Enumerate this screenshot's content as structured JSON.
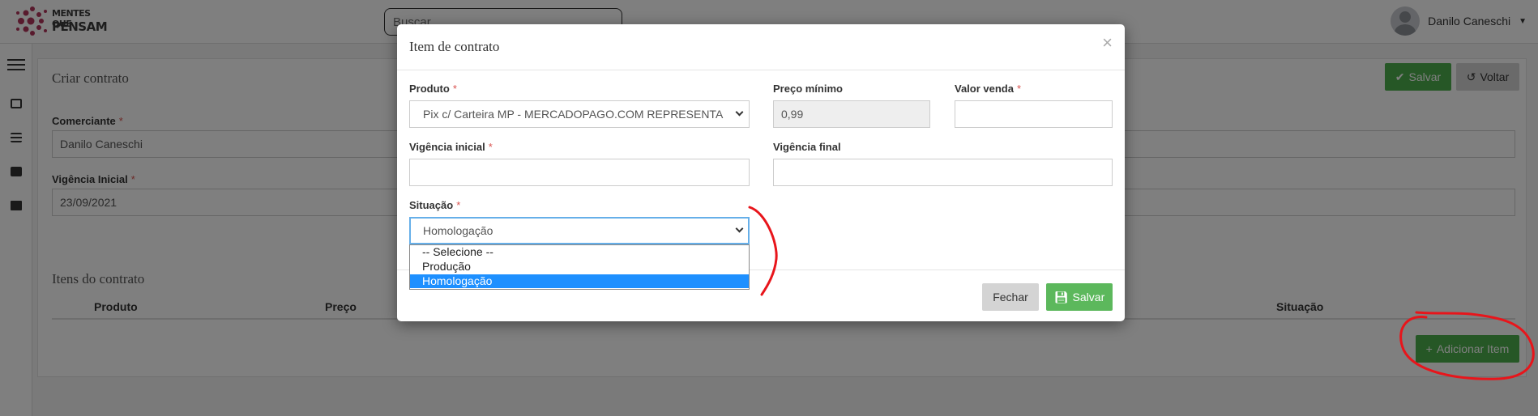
{
  "header": {
    "logo_line1": "MENTES QUE",
    "logo_line2": "PENSAM",
    "search_placeholder": "Buscar",
    "user_name": "Danilo Caneschi"
  },
  "sidebar": {
    "icons": [
      "menu-icon",
      "contact-icon",
      "list-icon",
      "id-card-icon",
      "mail-icon"
    ]
  },
  "page": {
    "title": "Criar contrato",
    "save_label": "Salvar",
    "back_label": "Voltar",
    "fields": {
      "comerciante_label": "Comerciante",
      "comerciante_value": "Danilo Caneschi",
      "vigencia_inicial_label": "Vigência Inicial",
      "vigencia_inicial_value": "23/09/2021"
    },
    "items_title": "Itens do contrato",
    "columns": [
      "Produto",
      "Preço",
      "Situação"
    ],
    "add_item_label": "Adicionar Item"
  },
  "modal": {
    "title": "Item de contrato",
    "close_symbol": "×",
    "produto_label": "Produto",
    "produto_value": "Pix c/ Carteira MP - MERCADOPAGO.COM REPRESENTA",
    "preco_minimo_label": "Preço mínimo",
    "preco_minimo_value": "0,99",
    "valor_venda_label": "Valor venda",
    "vigencia_inicial_label": "Vigência inicial",
    "vigencia_final_label": "Vigência final",
    "situacao_label": "Situação",
    "situacao_value": "Homologação",
    "situacao_options": [
      "-- Selecione --",
      "Produção",
      "Homologação"
    ],
    "fechar_label": "Fechar",
    "salvar_label": "Salvar",
    "required_mark": "*"
  },
  "colors": {
    "success": "#4cae4c",
    "danger": "#d9534f",
    "selected_option": "#1e90ff",
    "annotation": "#e8151b"
  }
}
